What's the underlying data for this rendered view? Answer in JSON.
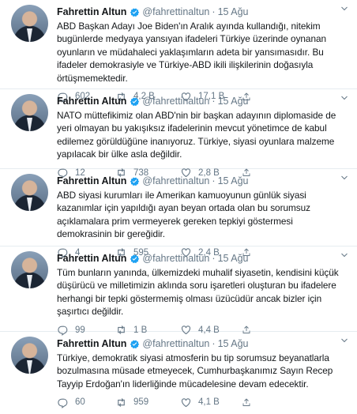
{
  "author": {
    "name": "Fahrettin Altun",
    "handle": "@fahrettinaltun",
    "separator": "·"
  },
  "tweets": [
    {
      "date": "15 Ağu",
      "text": "ABD Başkan Adayı Joe Biden'ın Aralık ayında kullandığı, nitekim bugünlerde medyaya yansıyan ifadeleri Türkiye üzerinde oynanan oyunların ve müdahaleci yaklaşımların adeta bir yansımasıdır. Bu ifadeler demokrasiyle ve Türkiye-ABD ikili ilişkilerinin doğasıyla örtüşmemektedir.",
      "replies": "602",
      "retweets": "4,2 B",
      "likes": "17,1 B"
    },
    {
      "date": "15 Ağu",
      "text": "NATO müttefikimiz olan ABD'nin bir başkan adayının diplomaside de yeri olmayan bu yakışıksız ifadelerinin mevcut yönetimce de kabul edilemez görüldüğüne inanıyoruz. Türkiye, siyasi oyunlara malzeme yapılacak bir ülke asla değildir.",
      "replies": "12",
      "retweets": "738",
      "likes": "2,8 B"
    },
    {
      "date": "15 Ağu",
      "text": "ABD siyasi kurumları ile Amerikan kamuoyunun günlük siyasi kazanımlar için yapıldığı ayan beyan ortada olan bu sorumsuz açıklamalara prim vermeyerek gereken tepkiyi göstermesi demokrasinin bir gereğidir.",
      "replies": "4",
      "retweets": "595",
      "likes": "2,4 B"
    },
    {
      "date": "15 Ağu",
      "text": "Tüm bunların yanında, ülkemizdeki muhalif siyasetin, kendisini küçük düşürücü ve milletimizin aklında soru işaretleri oluşturan bu ifadelere herhangi bir tepki göstermemiş olması üzücüdür ancak bizler için şaşırtıcı değildir.",
      "replies": "99",
      "retweets": "1 B",
      "likes": "4,4 B"
    },
    {
      "date": "15 Ağu",
      "text": "Türkiye, demokratik siyasi atmosferin bu tip sorumsuz beyanatlarla bozulmasına müsade etmeyecek, Cumhurbaşkanımız Sayın Recep Tayyip Erdoğan'ın liderliğinde mücadelesine devam edecektir.",
      "replies": "60",
      "retweets": "959",
      "likes": "4,1 B"
    }
  ],
  "icons": {
    "verified": "verified-badge-icon",
    "caret": "chevron-down-icon",
    "reply": "reply-icon",
    "retweet": "retweet-icon",
    "like": "heart-icon",
    "share": "share-icon"
  },
  "colors": {
    "verified": "#1da1f2",
    "muted": "#657786",
    "text": "#14171a"
  }
}
